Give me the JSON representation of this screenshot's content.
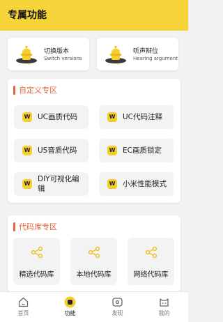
{
  "header": {
    "title": "专属功能"
  },
  "top_cards": [
    {
      "title": "切换版本",
      "subtitle": "Switch versions",
      "icon": "fire-hydrant-icon"
    },
    {
      "title": "听声辩位",
      "subtitle": "Hearing argument",
      "icon": "fire-hydrant-icon"
    }
  ],
  "custom_zone": {
    "title": "自定义专区",
    "items": [
      {
        "label": "UC画质代码",
        "icon": "w-badge-icon",
        "badge": "W"
      },
      {
        "label": "UC代码注释",
        "icon": "w-badge-icon",
        "badge": "W"
      },
      {
        "label": "US音质代码",
        "icon": "w-badge-icon",
        "badge": "W"
      },
      {
        "label": "EC画质锁定",
        "icon": "w-badge-icon",
        "badge": "W"
      },
      {
        "label": "DIY可视化编辑",
        "icon": "w-badge-icon",
        "badge": "W"
      },
      {
        "label": "小米性能模式",
        "icon": "w-badge-icon",
        "badge": "W"
      }
    ]
  },
  "library_zone": {
    "title": "代码库专区",
    "items": [
      {
        "label": "精选代码库",
        "icon": "share-icon"
      },
      {
        "label": "本地代码库",
        "icon": "share-icon"
      },
      {
        "label": "网络代码库",
        "icon": "share-icon"
      }
    ]
  },
  "bottom_nav": [
    {
      "label": "首页",
      "icon": "home-icon",
      "active": false
    },
    {
      "label": "功能",
      "icon": "function-icon",
      "active": true
    },
    {
      "label": "发现",
      "icon": "discover-icon",
      "active": false
    },
    {
      "label": "我的",
      "icon": "profile-icon",
      "active": false
    }
  ],
  "colors": {
    "header_bg": "#f7d53a",
    "accent": "#e8643c",
    "badge": "#f5cf2a",
    "panel_bg": "#ffffff",
    "tile_bg": "#f3f3f3",
    "page_bg": "#f2f2f4"
  }
}
